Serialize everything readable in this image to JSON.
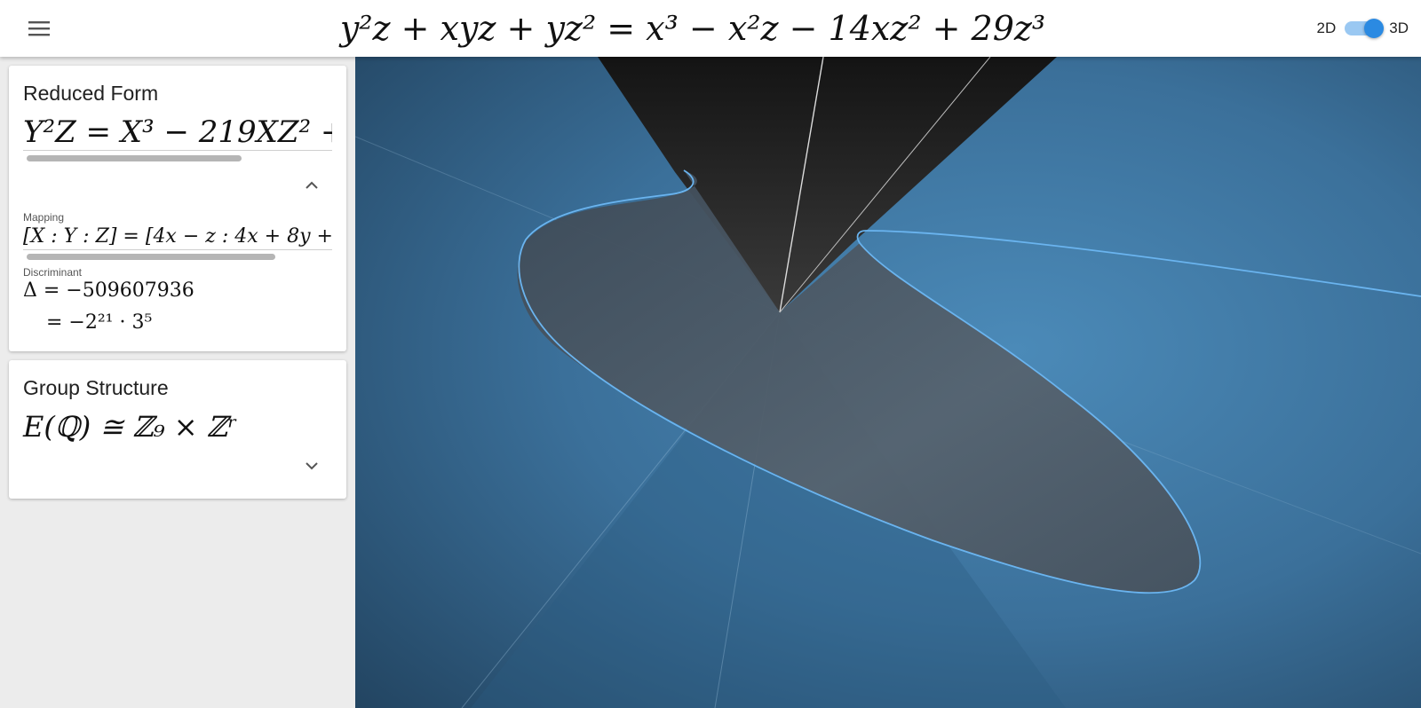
{
  "header": {
    "menu_icon": "hamburger-menu-icon",
    "equation": "y²z + xyz + yz² = x³ − x²z − 14xz² + 29z³",
    "toggle": {
      "left_label": "2D",
      "right_label": "3D",
      "selected": "3D"
    }
  },
  "reduced_form": {
    "title": "Reduced Form",
    "equation": "Y²Z = X³ − 219XZ² + ",
    "mapping_label": "Mapping",
    "mapping": "[X : Y : Z] = [4x − z : 4x + 8y + ·",
    "discriminant_label": "Discriminant",
    "discriminant_value": "Δ = −509607936",
    "discriminant_factored": "= −2²¹ · 3⁵"
  },
  "group_structure": {
    "title": "Group Structure",
    "formula": "E(ℚ) ≅  ℤ₉ × ℤʳ"
  },
  "colors": {
    "accent": "#2b8ae2",
    "curve": "#6ab4ef",
    "background_blue": "#3a6f98",
    "cone_dark": "#1c1c1c"
  }
}
